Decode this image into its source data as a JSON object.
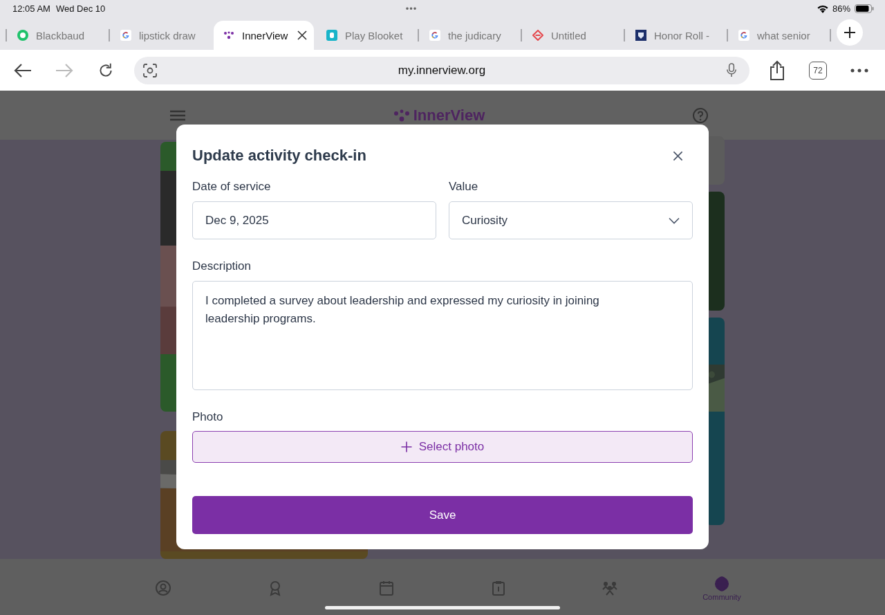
{
  "status_bar": {
    "time": "12:05 AM",
    "date": "Wed Dec 10",
    "dots": "•••",
    "battery": "86%"
  },
  "tabs": [
    {
      "label": "Blackbaud",
      "selected": false
    },
    {
      "label": "lipstick draw",
      "selected": false
    },
    {
      "label": "InnerView",
      "selected": true
    },
    {
      "label": "Play Blooket",
      "selected": false
    },
    {
      "label": "the judicary",
      "selected": false
    },
    {
      "label": "Untitled",
      "selected": false
    },
    {
      "label": "Honor Roll -",
      "selected": false
    },
    {
      "label": "what senior",
      "selected": false
    }
  ],
  "toolbar": {
    "url": "my.innerview.org",
    "tab_count": "72",
    "forward_disabled": true
  },
  "page": {
    "logo": "InnerView",
    "nav": [
      {
        "selected": false
      },
      {
        "selected": false
      },
      {
        "selected": false
      },
      {
        "selected": false
      },
      {
        "selected": false
      },
      {
        "label": "Community",
        "selected": true
      }
    ]
  },
  "dialog": {
    "title": "Update activity check-in",
    "date_label": "Date of service",
    "date_value": "Dec 9, 2025",
    "value_label": "Value",
    "value_value": "Curiosity",
    "description_label": "Description",
    "description_value": "I completed a survey about leadership and expressed my curiosity in joining leadership programs.",
    "photo_label": "Photo",
    "photo_button": "Select photo",
    "save_button": "Save"
  }
}
